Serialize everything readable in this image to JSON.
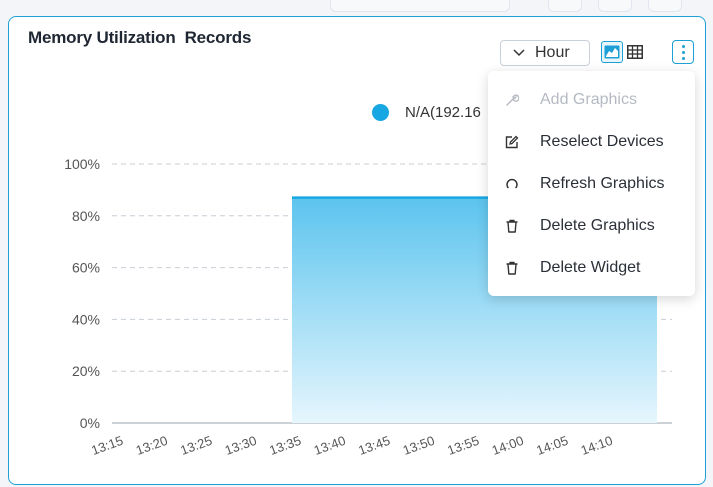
{
  "widget": {
    "title": "Memory Utilization  Records",
    "time_range": {
      "selected": "Hour",
      "chevron_icon": "chevron-down-icon"
    },
    "view_toggle": [
      {
        "icon": "area-chart-icon",
        "active": true
      },
      {
        "icon": "table-icon",
        "active": false
      }
    ],
    "more_icon": "more-vertical-icon"
  },
  "context_menu": {
    "items": [
      {
        "label": "Add Graphics",
        "icon": "wrench-icon",
        "enabled": false
      },
      {
        "label": "Reselect Devices",
        "icon": "edit-icon",
        "enabled": true
      },
      {
        "label": "Refresh Graphics",
        "icon": "refresh-icon",
        "enabled": true
      },
      {
        "label": "Delete Graphics",
        "icon": "trash-icon",
        "enabled": true
      },
      {
        "label": "Delete Widget",
        "icon": "trash-icon",
        "enabled": true
      }
    ]
  },
  "colors": {
    "accent": "#1ea0d6",
    "series": "#17a8e3",
    "area_top": "#5cc4ee",
    "area_bottom": "#e6f6fd"
  },
  "chart_data": {
    "type": "area",
    "title": "",
    "x": [
      "13:15",
      "13:20",
      "13:25",
      "13:30",
      "13:35",
      "13:40",
      "13:45",
      "13:50",
      "13:55",
      "14:00",
      "14:05",
      "14:10"
    ],
    "series": [
      {
        "name": "N/A(192.16",
        "values": [
          null,
          null,
          null,
          null,
          87,
          87,
          87,
          87,
          87,
          87,
          87,
          87
        ]
      }
    ],
    "y_ticks": [
      "0%",
      "20%",
      "40%",
      "60%",
      "80%",
      "100%"
    ],
    "ylim": [
      0,
      100
    ],
    "grid": true,
    "legend": "top"
  }
}
